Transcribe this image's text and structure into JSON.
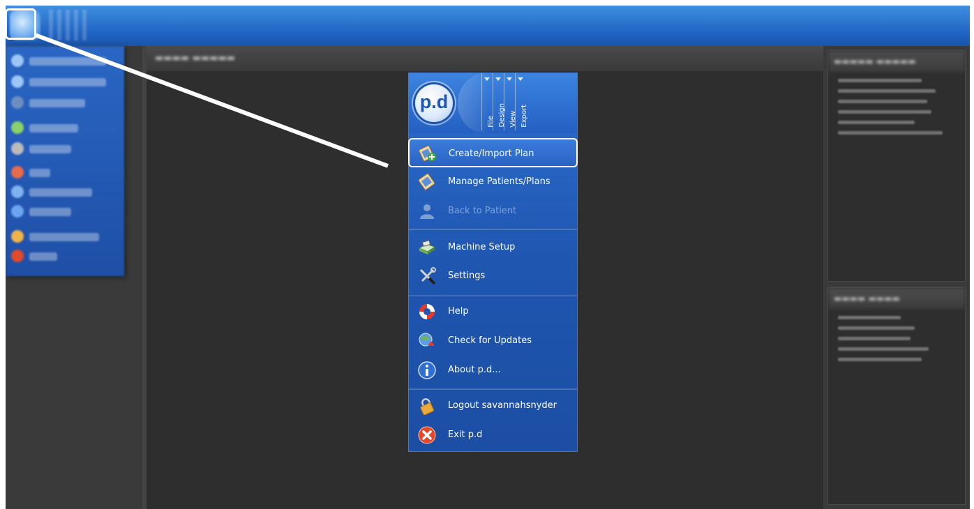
{
  "menu": {
    "logo_text": "p.d",
    "tabs": [
      {
        "label": "File"
      },
      {
        "label": "Design"
      },
      {
        "label": "View"
      },
      {
        "label": "Export"
      }
    ],
    "items": [
      {
        "label": "Create/Import Plan",
        "icon": "create-plan-icon"
      },
      {
        "label": "Manage Patients/Plans",
        "icon": "manage-patients-icon"
      },
      {
        "label": "Back to Patient",
        "icon": "patient-icon",
        "disabled": true
      },
      {
        "label": "Machine Setup",
        "icon": "machine-setup-icon"
      },
      {
        "label": "Settings",
        "icon": "wrench-screwdriver-icon"
      },
      {
        "label": "Help",
        "icon": "lifebuoy-icon"
      },
      {
        "label": "Check for Updates",
        "icon": "update-globe-icon"
      },
      {
        "label": "About p.d...",
        "icon": "info-icon"
      },
      {
        "label": "Logout savannahsnyder",
        "icon": "padlock-icon"
      },
      {
        "label": "Exit p.d",
        "icon": "exit-icon"
      }
    ]
  },
  "colors": {
    "menu_blue": "#1f56b0",
    "topbar_blue": "#2a6fd0",
    "background_dark": "#3a3a3a"
  }
}
